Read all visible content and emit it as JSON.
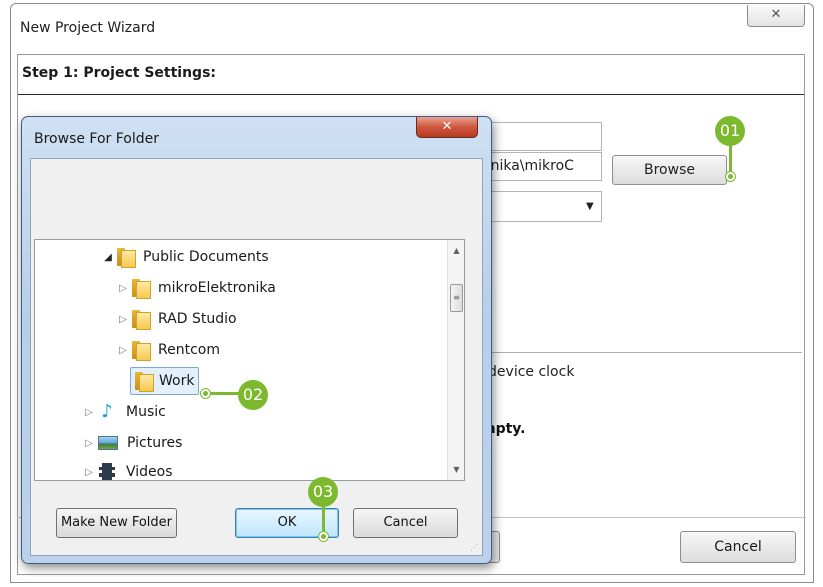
{
  "wizard": {
    "title": "New Project Wizard",
    "close_glyph": "✕",
    "step_title": "Step 1: Project Settings:",
    "path_fragment": "onika\\mikroC",
    "browse_label": "Browse",
    "clock_text": "a device clock",
    "empty_text": "mpty.",
    "cancel_label": "Cancel"
  },
  "browse_dialog": {
    "title": "Browse For Folder",
    "close_glyph": "✕",
    "tree": [
      {
        "label": "Public Documents",
        "icon": "folder-icon",
        "expander": "◢"
      },
      {
        "label": "mikroElektronika",
        "icon": "folder-icon",
        "expander": "▷"
      },
      {
        "label": "RAD Studio",
        "icon": "folder-icon",
        "expander": "▷"
      },
      {
        "label": "Rentcom",
        "icon": "folder-icon",
        "expander": "▷"
      },
      {
        "label": "Work",
        "icon": "folder-icon",
        "expander": "",
        "selected": true
      },
      {
        "label": "Music",
        "icon": "music-icon",
        "expander": "▷"
      },
      {
        "label": "Pictures",
        "icon": "pictures-icon",
        "expander": "▷"
      },
      {
        "label": "Videos",
        "icon": "videos-icon",
        "expander": "▷"
      }
    ],
    "scroll_up": "▲",
    "scroll_down": "▼",
    "scroll_grip": "≡",
    "make_new_folder_label": "Make New Folder",
    "ok_label": "OK",
    "cancel_label": "Cancel"
  },
  "callouts": {
    "one": "01",
    "two": "02",
    "three": "03",
    "color": "#7cb92f"
  }
}
